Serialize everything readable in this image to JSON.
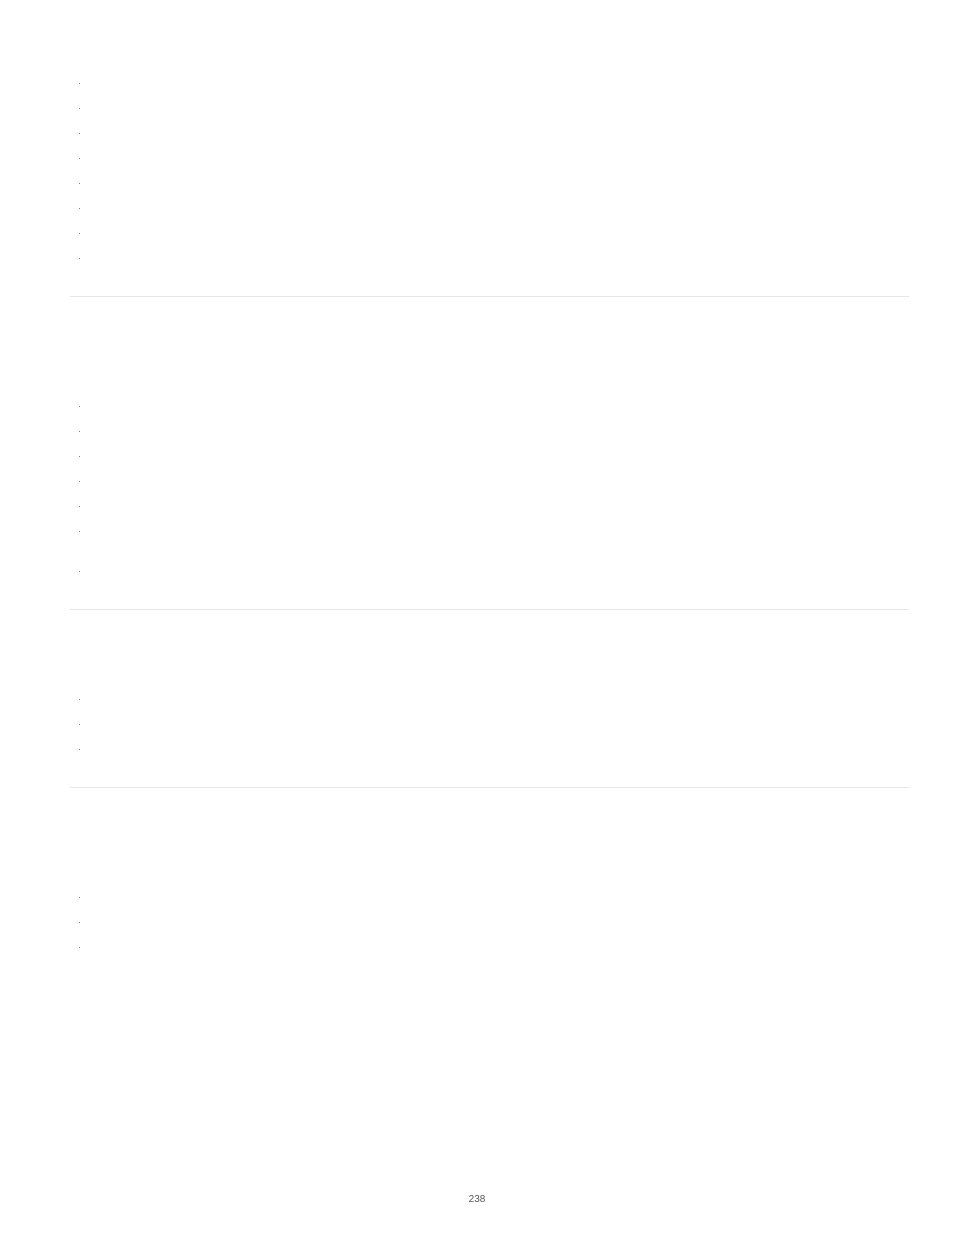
{
  "page": {
    "number": "238"
  },
  "sections": [
    {
      "bullet_count": 8
    },
    {
      "bullet_count": 7
    },
    {
      "bullet_count": 3
    },
    {
      "bullet_count": 3
    }
  ]
}
